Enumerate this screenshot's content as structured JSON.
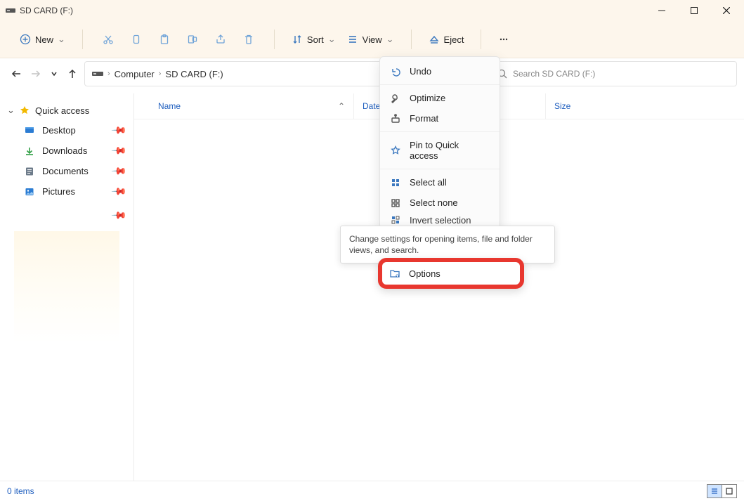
{
  "window": {
    "title": "SD CARD (F:)"
  },
  "win_controls": {
    "min": "minimize",
    "max": "maximize",
    "close": "close"
  },
  "toolbar": {
    "new_label": "New",
    "sort_label": "Sort",
    "view_label": "View",
    "eject_label": "Eject"
  },
  "nav": {
    "root": "Computer",
    "current": "SD CARD (F:)"
  },
  "search": {
    "placeholder": "Search SD CARD (F:)"
  },
  "sidebar": {
    "header": "Quick access",
    "items": [
      {
        "label": "Desktop"
      },
      {
        "label": "Downloads"
      },
      {
        "label": "Documents"
      },
      {
        "label": "Pictures"
      }
    ]
  },
  "columns": {
    "name": "Name",
    "date": "Date modified",
    "size": "Size"
  },
  "context_menu": {
    "undo": "Undo",
    "optimize": "Optimize",
    "format": "Format",
    "pin": "Pin to Quick access",
    "select_all": "Select all",
    "select_none": "Select none",
    "invert": "Invert selection",
    "options": "Options"
  },
  "tooltip": {
    "text": "Change settings for opening items, file and folder views, and search."
  },
  "status": {
    "item_count": "0 items"
  }
}
